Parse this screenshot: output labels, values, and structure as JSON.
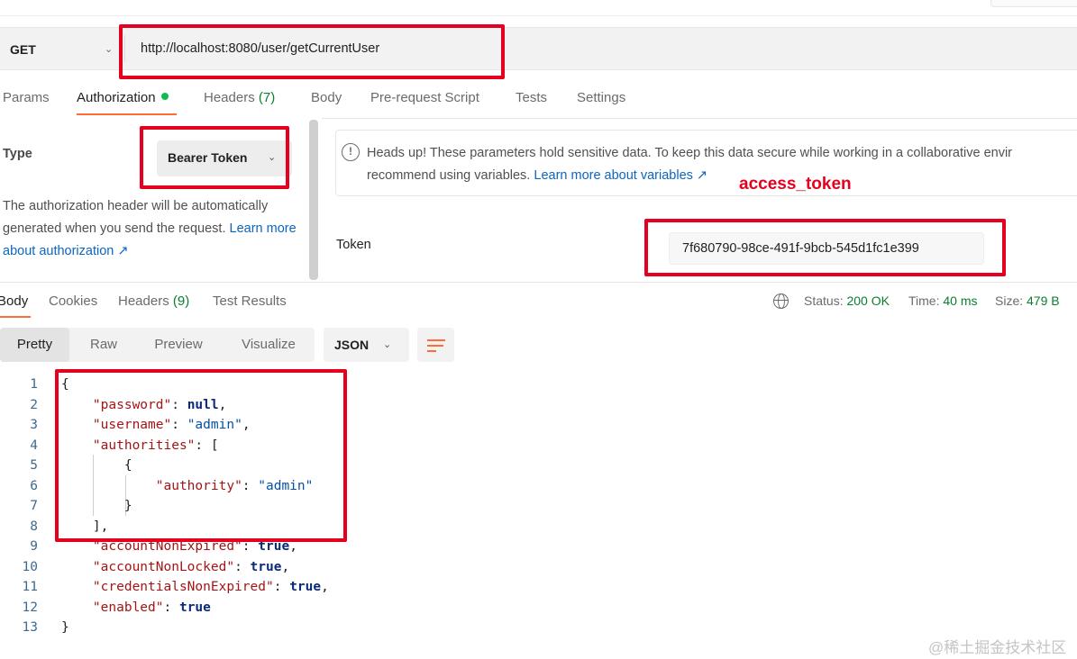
{
  "request": {
    "method": "GET",
    "url": "http://localhost:8080/user/getCurrentUser"
  },
  "request_tabs": {
    "params": "Params",
    "authorization": "Authorization",
    "headers_label": "Headers",
    "headers_count": "(7)",
    "body": "Body",
    "prerequest": "Pre-request Script",
    "tests": "Tests",
    "settings": "Settings"
  },
  "auth": {
    "type_label": "Type",
    "type_value": "Bearer Token",
    "description": "The authorization header will be automatically generated when you send the request.",
    "learn_more": "Learn more about authorization ↗",
    "notice_line1": "Heads up! These parameters hold sensitive data. To keep this data secure while working in a collaborative envir",
    "notice_line2": "recommend using variables.",
    "notice_link": "Learn more about variables ↗",
    "token_label": "Token",
    "token_value": "7f680790-98ce-491f-9bcb-545d1fc1e399"
  },
  "annotation": {
    "access_token": "access_token"
  },
  "response_tabs": {
    "body": "Body",
    "cookies": "Cookies",
    "headers_label": "Headers",
    "headers_count": "(9)",
    "test_results": "Test Results"
  },
  "status": {
    "status_label": "Status:",
    "status_value": "200 OK",
    "time_label": "Time:",
    "time_value": "40 ms",
    "size_label": "Size:",
    "size_value": "479 B"
  },
  "view_modes": {
    "pretty": "Pretty",
    "raw": "Raw",
    "preview": "Preview",
    "visualize": "Visualize",
    "format": "JSON"
  },
  "code_lines": [
    {
      "n": "1"
    },
    {
      "n": "2"
    },
    {
      "n": "3"
    },
    {
      "n": "4"
    },
    {
      "n": "5"
    },
    {
      "n": "6"
    },
    {
      "n": "7"
    },
    {
      "n": "8"
    },
    {
      "n": "9"
    },
    {
      "n": "10"
    },
    {
      "n": "11"
    },
    {
      "n": "12"
    },
    {
      "n": "13"
    }
  ],
  "json_body": {
    "open": "{",
    "password_key": "\"password\"",
    "password_val": "null",
    "username_key": "\"username\"",
    "username_val": "\"admin\"",
    "authorities_key": "\"authorities\"",
    "authorities_open": "[",
    "obj_open": "{",
    "authority_key": "\"authority\"",
    "authority_val": "\"admin\"",
    "obj_close": "}",
    "authorities_close": "],",
    "accountNonExpired_key": "\"accountNonExpired\"",
    "accountNonExpired_val": "true",
    "accountNonLocked_key": "\"accountNonLocked\"",
    "accountNonLocked_val": "true",
    "credentialsNonExpired_key": "\"credentialsNonExpired\"",
    "credentialsNonExpired_val": "true",
    "enabled_key": "\"enabled\"",
    "enabled_val": "true",
    "close": "}"
  },
  "watermark": "@稀土掘金技术社区",
  "colors": {
    "accent": "#ff6c37",
    "annotation_red": "#e6001f",
    "status_green": "#0a7e2f",
    "link_blue": "#0b65c2"
  }
}
